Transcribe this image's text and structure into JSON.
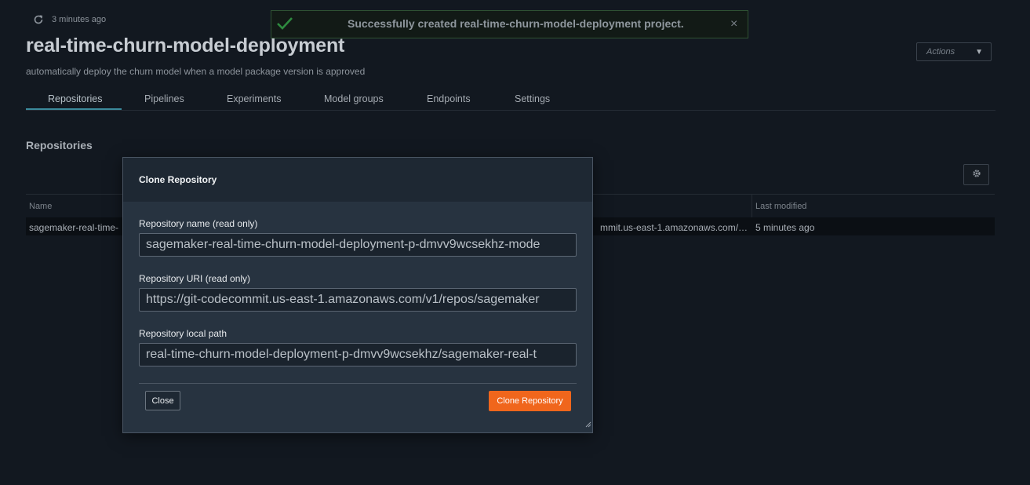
{
  "refresh": {
    "timestamp": "3 minutes ago",
    "icon": "refresh-icon"
  },
  "project": {
    "title": "real-time-churn-model-deployment",
    "description": "automatically deploy the churn model when a model package version is approved"
  },
  "actions": {
    "label": "Actions",
    "icon": "caret-down-icon"
  },
  "tabs": [
    {
      "label": "Repositories",
      "active": true
    },
    {
      "label": "Pipelines",
      "active": false
    },
    {
      "label": "Experiments",
      "active": false
    },
    {
      "label": "Model groups",
      "active": false
    },
    {
      "label": "Endpoints",
      "active": false
    },
    {
      "label": "Settings",
      "active": false
    }
  ],
  "repositories": {
    "section_title": "Repositories",
    "settings_icon": "gear-icon",
    "columns": [
      "Name",
      "Last modified"
    ],
    "rows": [
      {
        "name": "sagemaker-real-time-",
        "url": "mmit.us-east-1.amazonaws.com/…",
        "last_modified": "5 minutes ago"
      }
    ]
  },
  "toast": {
    "message": "Successfully created real-time-churn-model-deployment project.",
    "status_icon": "checkmark-icon",
    "close_icon": "close-icon",
    "close_glyph": "×",
    "accent_color": "#2e8b3f"
  },
  "modal": {
    "title": "Clone Repository",
    "fields": [
      {
        "label": "Repository name (read only)",
        "value": "sagemaker-real-time-churn-model-deployment-p-dmvv9wcsekhz-mode"
      },
      {
        "label": "Repository URI (read only)",
        "value": "https://git-codecommit.us-east-1.amazonaws.com/v1/repos/sagemaker"
      },
      {
        "label": "Repository local path",
        "value": "real-time-churn-model-deployment-p-dmvv9wcsekhz/sagemaker-real-t"
      }
    ],
    "close_label": "Close",
    "clone_label": "Clone Repository",
    "clone_color": "#f0661c"
  }
}
